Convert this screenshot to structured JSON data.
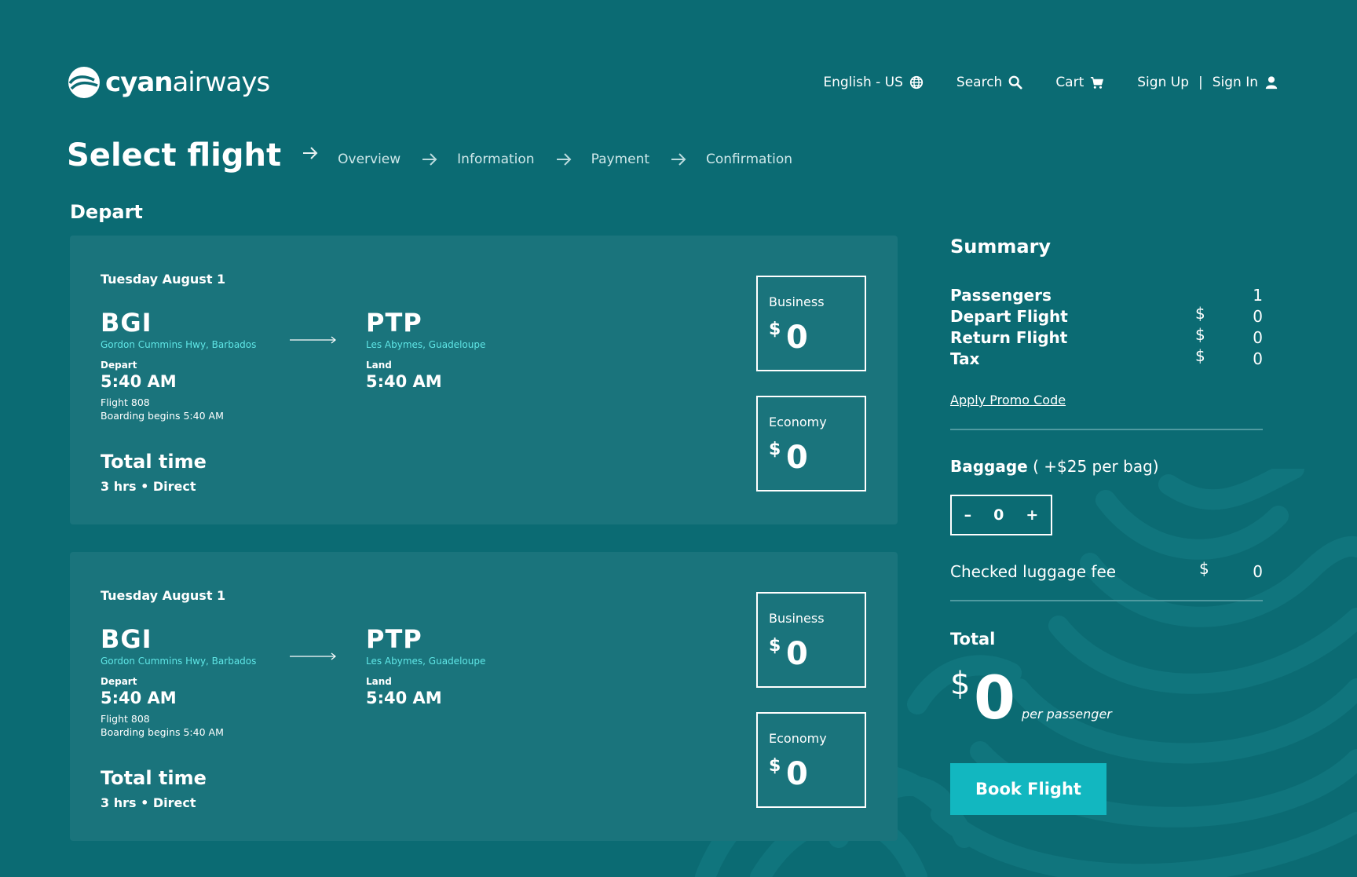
{
  "brand": {
    "bold": "cyan",
    "light": "airways"
  },
  "nav": {
    "language": "English - US",
    "search": "Search",
    "cart": "Cart",
    "signup": "Sign Up",
    "separator": "|",
    "signin": "Sign In"
  },
  "steps": {
    "current": "Select flight",
    "items": [
      "Overview",
      "Information",
      "Payment",
      "Confirmation"
    ]
  },
  "section": "Depart",
  "flights": [
    {
      "date": "Tuesday August 1",
      "origin": {
        "code": "BGI",
        "location": "Gordon Cummins Hwy, Barbados",
        "label": "Depart",
        "time": "5:40 AM"
      },
      "dest": {
        "code": "PTP",
        "location": "Les Abymes, Guadeloupe",
        "label": "Land",
        "time": "5:40 AM"
      },
      "flight_no": "Flight 808",
      "boarding": "Boarding begins 5:40 AM",
      "total_time_label": "Total time",
      "duration": "3 hrs  •  Direct",
      "fares": [
        {
          "label": "Business",
          "currency": "$",
          "value": "0"
        },
        {
          "label": "Economy",
          "currency": "$",
          "value": "0"
        }
      ]
    },
    {
      "date": "Tuesday August 1",
      "origin": {
        "code": "BGI",
        "location": "Gordon Cummins Hwy, Barbados",
        "label": "Depart",
        "time": "5:40 AM"
      },
      "dest": {
        "code": "PTP",
        "location": "Les Abymes, Guadeloupe",
        "label": "Land",
        "time": "5:40 AM"
      },
      "flight_no": "Flight 808",
      "boarding": "Boarding begins 5:40 AM",
      "total_time_label": "Total time",
      "duration": "3 hrs  •  Direct",
      "fares": [
        {
          "label": "Business",
          "currency": "$",
          "value": "0"
        },
        {
          "label": "Economy",
          "currency": "$",
          "value": "0"
        }
      ]
    }
  ],
  "summary": {
    "title": "Summary",
    "rows": [
      {
        "label": "Passengers",
        "currency": "",
        "value": "1"
      },
      {
        "label": "Depart Flight",
        "currency": "$",
        "value": "0"
      },
      {
        "label": "Return Flight",
        "currency": "$",
        "value": "0"
      },
      {
        "label": "Tax",
        "currency": "$",
        "value": "0"
      }
    ],
    "promo": "Apply Promo Code",
    "baggage_title": "Baggage",
    "baggage_note": " ( +$25 per bag)",
    "bag_minus": "–",
    "bag_count": "0",
    "bag_plus": "+",
    "fee_label": "Checked luggage fee",
    "fee_currency": "$",
    "fee_value": "0",
    "total_label": "Total",
    "total_currency": "$",
    "total_value": "0",
    "per_passenger": "per passenger",
    "book_button": "Book Flight"
  },
  "colors": {
    "background": "#0b6b73",
    "card": "#1a747c",
    "accent": "#12b7c0",
    "location_text": "#5fe6e6"
  }
}
